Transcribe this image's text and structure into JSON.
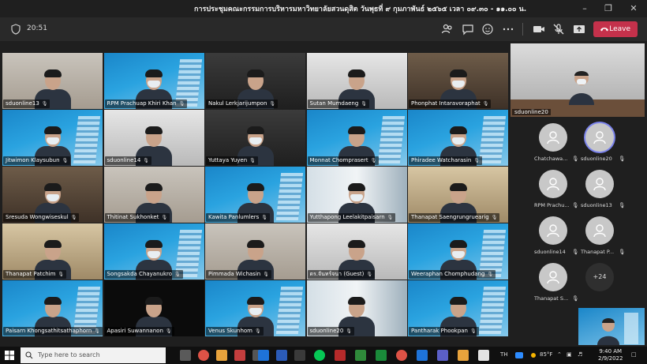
{
  "window": {
    "title": "การประชุมคณะกรรมการบริหารมหาวิทยาลัยสวนดุสิต วันพุธที่ ๙ กุมภาพันธ์ ๒๕๖๕ เวลา ๐๙.๓๐ - ๑๑.๐๐ น."
  },
  "toolbar": {
    "timer": "20:51",
    "leave_label": "Leave",
    "leave_color": "#c4314b"
  },
  "tiles": [
    {
      "name": "sduonline13",
      "bg": "office"
    },
    {
      "name": "RPM  Prachuap Khiri Khan",
      "bg": "blue"
    },
    {
      "name": "Nakul Lerkjarijumpon",
      "bg": "dark"
    },
    {
      "name": "Sutan Mumdaeng",
      "bg": "white"
    },
    {
      "name": "Phonphat Intaravoraphat",
      "bg": "room"
    },
    {
      "name": "Jitwimon Klaysubun",
      "bg": "blue"
    },
    {
      "name": "sduonline14",
      "bg": "white"
    },
    {
      "name": "Yuttaya Yuyen",
      "bg": "dark"
    },
    {
      "name": "Monnat Chomprasert",
      "bg": "blue"
    },
    {
      "name": "Phiradee Watcharasin",
      "bg": "blue"
    },
    {
      "name": "Sresuda Wongwiseskul",
      "bg": "room"
    },
    {
      "name": "Thitinat Sukhonket",
      "bg": "office"
    },
    {
      "name": "Kawita Panlumlers",
      "bg": "blue"
    },
    {
      "name": "Yutthapong Leelakitpaisarn",
      "bg": "window"
    },
    {
      "name": "Thanapat Saengrungruearig",
      "bg": "curtain"
    },
    {
      "name": "Thanapat Patchim",
      "bg": "curtain"
    },
    {
      "name": "Songsakda Chayanukro",
      "bg": "blue"
    },
    {
      "name": "Pimmada Wichasin",
      "bg": "office"
    },
    {
      "name": "ดร.จันทร์จนา (Guest)",
      "bg": "white"
    },
    {
      "name": "Weeraphan Chomphudang",
      "bg": "blue"
    },
    {
      "name": "Paisarn Khongsathitsathaphorn",
      "bg": "blue"
    },
    {
      "name": "Apasiri Suwannanon",
      "bg": "black"
    },
    {
      "name": "Venus Skunhom",
      "bg": "blue"
    },
    {
      "name": "sduonline20",
      "bg": "window"
    },
    {
      "name": "Pantharak Phookpan",
      "bg": "blue"
    }
  ],
  "feature": {
    "name": "sduonline20"
  },
  "roster": [
    {
      "name": "Chatchawa..."
    },
    {
      "name": "sduonline20",
      "active": true
    },
    {
      "name": "RPM  Prachu..."
    },
    {
      "name": "sduonline13"
    },
    {
      "name": "sduonline14"
    },
    {
      "name": "Thanapat P..."
    },
    {
      "name": "Thanapat S..."
    }
  ],
  "more_count": "+24",
  "taskbar": {
    "search_placeholder": "Type here to search",
    "lang": "TH",
    "weather": "85°F",
    "time": "9:40 AM",
    "date": "2/9/2022"
  }
}
